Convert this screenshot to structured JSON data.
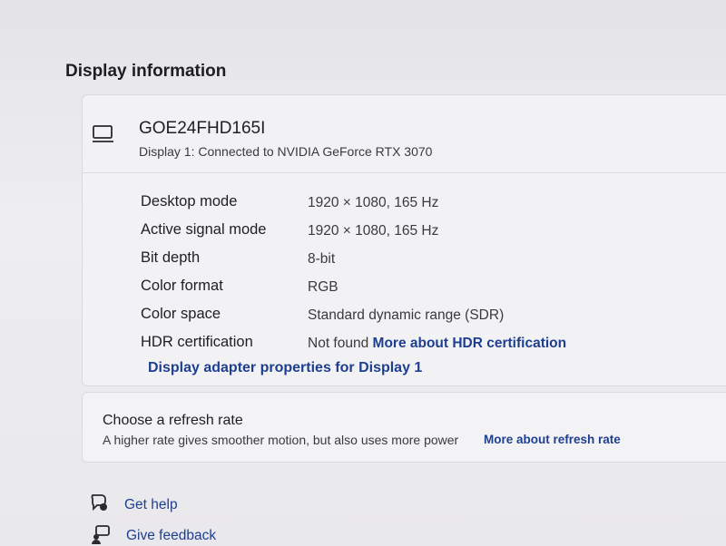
{
  "section": {
    "title": "Display information"
  },
  "monitor": {
    "name": "GOE24FHD165I",
    "connection": "Display 1: Connected to NVIDIA GeForce RTX 3070",
    "icon": "monitor-icon"
  },
  "properties": [
    {
      "label": "Desktop mode",
      "value": "1920 × 1080, 165 Hz"
    },
    {
      "label": "Active signal mode",
      "value": "1920 × 1080, 165 Hz"
    },
    {
      "label": "Bit depth",
      "value": "8-bit"
    },
    {
      "label": "Color format",
      "value": "RGB"
    },
    {
      "label": "Color space",
      "value": "Standard dynamic range (SDR)"
    },
    {
      "label": "HDR certification",
      "value": "Not found",
      "link": "More about HDR certification"
    }
  ],
  "adapter_link": "Display adapter properties for Display 1",
  "refresh": {
    "title": "Choose a refresh rate",
    "description": "A higher rate gives smoother motion, but also uses more power",
    "link": "More about refresh rate"
  },
  "footer": {
    "get_help": "Get help",
    "give_feedback": "Give feedback"
  },
  "colors": {
    "link": "#1e3f8f",
    "text": "#1f1f22"
  }
}
